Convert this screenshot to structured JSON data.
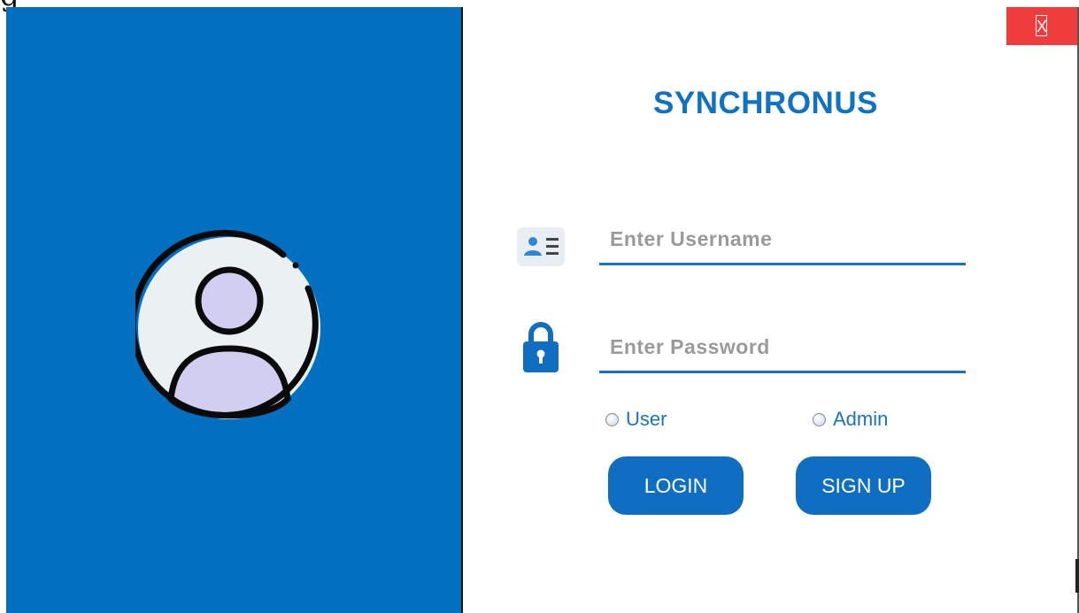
{
  "app": {
    "title": "SYNCHRONUS",
    "close_label": "X"
  },
  "corner_glyph": "g",
  "form": {
    "username_placeholder": "Enter Username",
    "password_placeholder": "Enter Password",
    "role_options": [
      "User",
      "Admin"
    ],
    "login_label": "LOGIN",
    "signup_label": "SIGN UP"
  },
  "icons": {
    "avatar": "user-circle-icon",
    "username": "id-card-icon",
    "password": "lock-icon",
    "close": "close-icon"
  },
  "colors": {
    "brand_blue": "#0270c0",
    "accent_blue": "#1a72c2",
    "close_red": "#f03c3c",
    "avatar_face": "#d1cef1",
    "avatar_bg": "#ebf0f3"
  }
}
